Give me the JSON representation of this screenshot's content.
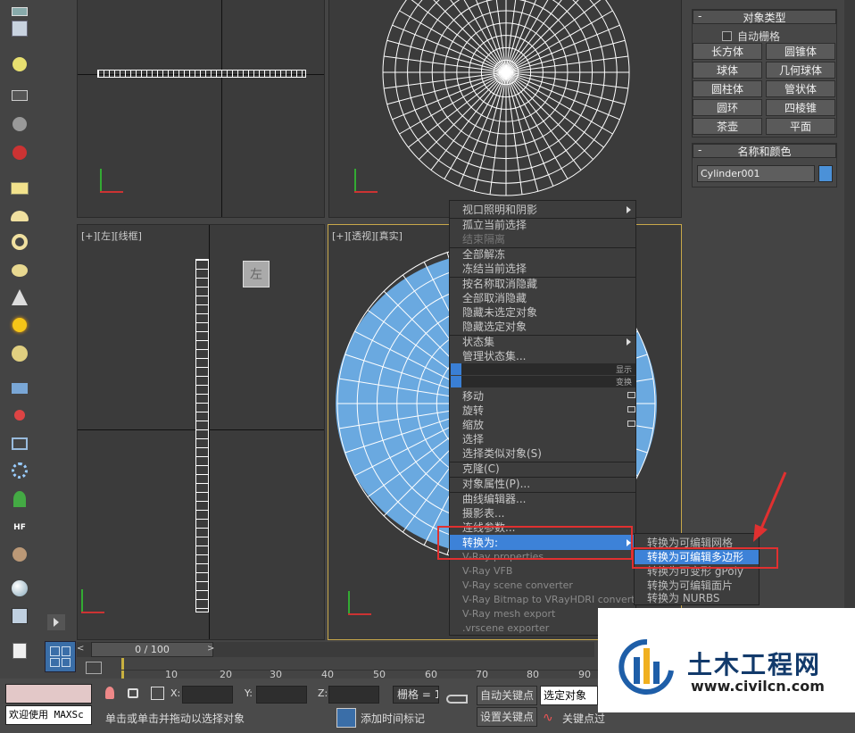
{
  "viewports": {
    "left_label": "[+][左][线框]",
    "persp_label": "[+][透视][真实]",
    "cube_label": "左"
  },
  "command_panel": {
    "object_type": {
      "title": "对象类型",
      "autogrid": "自动栅格",
      "buttons": [
        "长方体",
        "圆锥体",
        "球体",
        "几何球体",
        "圆柱体",
        "管状体",
        "圆环",
        "四棱锥",
        "茶壶",
        "平面"
      ]
    },
    "name_color": {
      "title": "名称和颜色",
      "object_name": "Cylinder001",
      "swatch_color": "#4b91d8"
    }
  },
  "quad_menu": {
    "items": [
      "视口照明和阴影",
      "孤立当前选择",
      "结束隔离",
      "全部解冻",
      "冻结当前选择",
      "按名称取消隐藏",
      "全部取消隐藏",
      "隐藏未选定对象",
      "隐藏选定对象",
      "状态集",
      "管理状态集..."
    ],
    "quad_display": "显示",
    "quad_transform": "变换",
    "transform_items": [
      "移动",
      "旋转",
      "缩放",
      "选择",
      "选择类似对象(S)",
      "克隆(C)",
      "对象属性(P)...",
      "曲线编辑器...",
      "摄影表...",
      "连线参数...",
      "转换为:"
    ],
    "vray_items": [
      "V-Ray properties",
      "V-Ray VFB",
      "V-Ray scene converter",
      "V-Ray Bitmap to VRayHDRI converter",
      "V-Ray mesh export",
      ".vrscene exporter"
    ]
  },
  "convert_submenu": [
    "转换为可编辑网格",
    "转换为可编辑多边形",
    "转换为可变形 gPoly",
    "转换为可编辑面片",
    "转换为 NURBS"
  ],
  "timeline": {
    "slider": "0 / 100",
    "ticks": [
      "0",
      "10",
      "20",
      "30",
      "40",
      "50",
      "60",
      "70",
      "80",
      "90"
    ]
  },
  "status": {
    "maxscript": "欢迎使用 MAXSc",
    "hint": "单击或单击并拖动以选择对象",
    "x_label": "X:",
    "y_label": "Y:",
    "z_label": "Z:",
    "grid": "栅格 = 1",
    "add_time_tag": "添加时间标记",
    "auto_key": "自动关键点",
    "set_key": "设置关键点",
    "selected": "选定对象",
    "key_filters": "关键点过"
  },
  "watermark": {
    "title": "土木工程网",
    "url": "www.civilcn.com"
  }
}
